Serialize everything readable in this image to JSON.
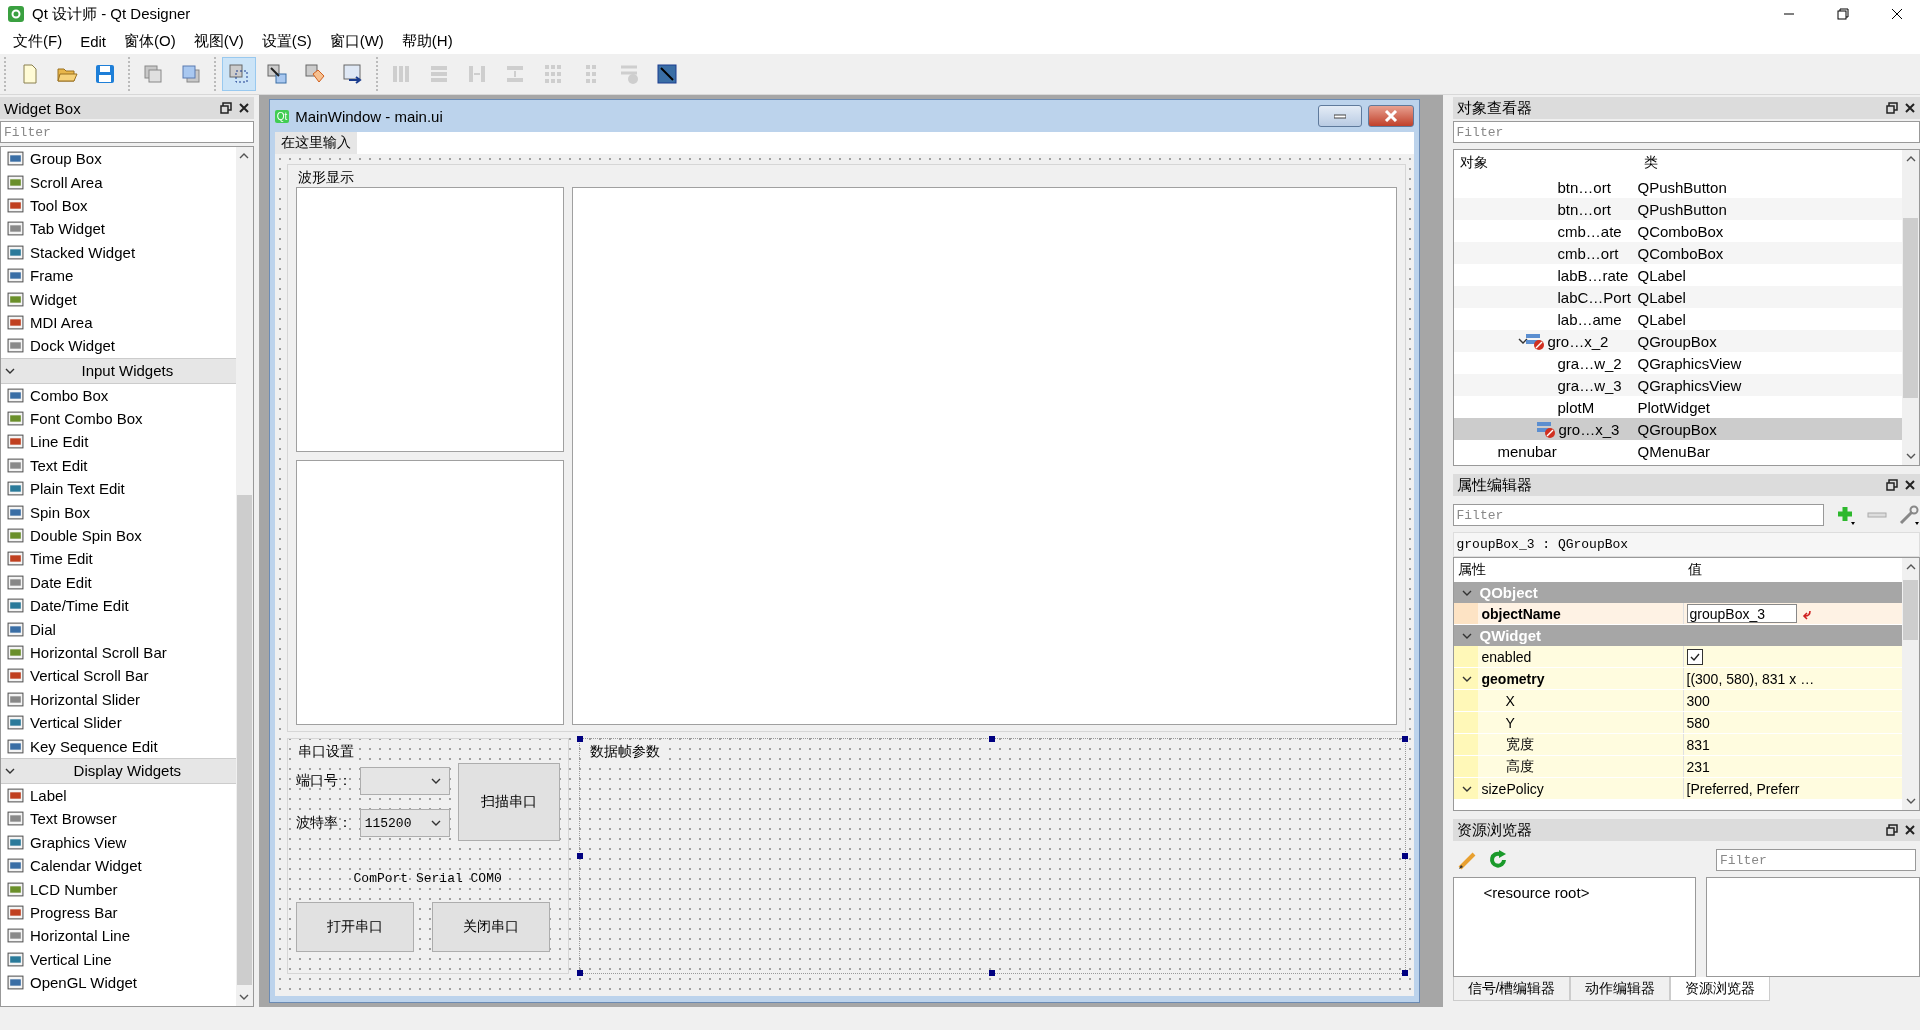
{
  "window": {
    "title": "Qt 设计师 - Qt Designer"
  },
  "menu": [
    "文件(F)",
    "Edit",
    "窗体(O)",
    "视图(V)",
    "设置(S)",
    "窗口(W)",
    "帮助(H)"
  ],
  "toolbar": [
    {
      "buttons": [
        {
          "kind": "new",
          "selected": false,
          "disabled": false
        },
        {
          "kind": "open",
          "selected": false,
          "disabled": false
        },
        {
          "kind": "save",
          "selected": false,
          "disabled": false
        }
      ]
    },
    {
      "buttons": [
        {
          "kind": "front",
          "selected": false,
          "disabled": false
        },
        {
          "kind": "back",
          "selected": false,
          "disabled": false
        }
      ]
    },
    {
      "buttons": [
        {
          "kind": "edit",
          "selected": true,
          "disabled": false
        },
        {
          "kind": "signals",
          "selected": false,
          "disabled": false
        },
        {
          "kind": "buddies",
          "selected": false,
          "disabled": false
        },
        {
          "kind": "taborder",
          "selected": false,
          "disabled": false
        }
      ]
    },
    {
      "buttons": [
        {
          "kind": "hlayout",
          "selected": false,
          "disabled": true
        },
        {
          "kind": "vlayout",
          "selected": false,
          "disabled": true
        },
        {
          "kind": "hsplit",
          "selected": false,
          "disabled": true
        },
        {
          "kind": "vsplit",
          "selected": false,
          "disabled": true
        },
        {
          "kind": "grid",
          "selected": false,
          "disabled": true
        },
        {
          "kind": "form",
          "selected": false,
          "disabled": true
        },
        {
          "kind": "break",
          "selected": false,
          "disabled": true
        },
        {
          "kind": "adjust",
          "selected": false,
          "disabled": false
        }
      ]
    }
  ],
  "widget_box": {
    "title": "Widget Box",
    "filter": {
      "placeholder": "Filter"
    },
    "items": [
      {
        "kind": "item",
        "label": "Group Box"
      },
      {
        "kind": "item",
        "label": "Scroll Area"
      },
      {
        "kind": "item",
        "label": "Tool Box"
      },
      {
        "kind": "item",
        "label": "Tab Widget"
      },
      {
        "kind": "item",
        "label": "Stacked Widget"
      },
      {
        "kind": "item",
        "label": "Frame"
      },
      {
        "kind": "item",
        "label": "Widget"
      },
      {
        "kind": "item",
        "label": "MDI Area"
      },
      {
        "kind": "item",
        "label": "Dock Widget"
      },
      {
        "kind": "category",
        "label": "Input Widgets",
        "expanded": true
      },
      {
        "kind": "item",
        "label": "Combo Box"
      },
      {
        "kind": "item",
        "label": "Font Combo Box"
      },
      {
        "kind": "item",
        "label": "Line Edit"
      },
      {
        "kind": "item",
        "label": "Text Edit"
      },
      {
        "kind": "item",
        "label": "Plain Text Edit"
      },
      {
        "kind": "item",
        "label": "Spin Box"
      },
      {
        "kind": "item",
        "label": "Double Spin Box"
      },
      {
        "kind": "item",
        "label": "Time Edit"
      },
      {
        "kind": "item",
        "label": "Date Edit"
      },
      {
        "kind": "item",
        "label": "Date/Time Edit"
      },
      {
        "kind": "item",
        "label": "Dial"
      },
      {
        "kind": "item",
        "label": "Horizontal Scroll Bar"
      },
      {
        "kind": "item",
        "label": "Vertical Scroll Bar"
      },
      {
        "kind": "item",
        "label": "Horizontal Slider"
      },
      {
        "kind": "item",
        "label": "Vertical Slider"
      },
      {
        "kind": "item",
        "label": "Key Sequence Edit"
      },
      {
        "kind": "category",
        "label": "Display Widgets",
        "expanded": true
      },
      {
        "kind": "item",
        "label": "Label"
      },
      {
        "kind": "item",
        "label": "Text Browser"
      },
      {
        "kind": "item",
        "label": "Graphics View"
      },
      {
        "kind": "item",
        "label": "Calendar Widget"
      },
      {
        "kind": "item",
        "label": "LCD Number"
      },
      {
        "kind": "item",
        "label": "Progress Bar"
      },
      {
        "kind": "item",
        "label": "Horizontal Line"
      },
      {
        "kind": "item",
        "label": "Vertical Line"
      },
      {
        "kind": "item",
        "label": "OpenGL Widget"
      }
    ]
  },
  "form": {
    "logo": "Qt",
    "title": "MainWindow - main.ui",
    "menubar_item": "在这里输入",
    "wave_group": {
      "title": "波形显示",
      "selected": false
    },
    "serial_group": {
      "title": "串口设置",
      "selected": false,
      "port_label": "端口号：",
      "baud_label": "波特率：",
      "baud_value": "115200",
      "scan_button": "扫描串口",
      "status": "ComPort Serial COM0",
      "open_button": "打开串口",
      "close_button": "关闭串口"
    },
    "frame_group": {
      "title": "数据帧参数",
      "selected": true
    }
  },
  "object_inspector": {
    "title": "对象查看器",
    "filter": {
      "placeholder": "Filter"
    },
    "columns": [
      "对象",
      "类"
    ],
    "items": [
      {
        "kind": "widget",
        "object": "btn…ort",
        "class": "QPushButton",
        "selected": false
      },
      {
        "kind": "widget",
        "object": "btn…ort",
        "class": "QPushButton",
        "selected": false
      },
      {
        "kind": "widget",
        "object": "cmb…ate",
        "class": "QComboBox",
        "selected": false
      },
      {
        "kind": "widget",
        "object": "cmb…ort",
        "class": "QComboBox",
        "selected": false
      },
      {
        "kind": "widget",
        "object": "labB…rate",
        "class": "QLabel",
        "selected": false
      },
      {
        "kind": "widget",
        "object": "labC…Port",
        "class": "QLabel",
        "selected": false
      },
      {
        "kind": "widget",
        "object": "lab…ame",
        "class": "QLabel",
        "selected": false
      },
      {
        "kind": "container",
        "object": "gro…x_2",
        "class": "QGroupBox",
        "selected": false,
        "expanded": true,
        "children": [
          {
            "kind": "widget",
            "object": "gra…w_2",
            "class": "QGraphicsView",
            "selected": false
          },
          {
            "kind": "widget",
            "object": "gra…w_3",
            "class": "QGraphicsView",
            "selected": false
          },
          {
            "kind": "widget",
            "object": "plotM",
            "class": "PlotWidget",
            "selected": false
          }
        ]
      },
      {
        "kind": "container",
        "object": "gro…x_3",
        "class": "QGroupBox",
        "selected": true
      }
    ],
    "parent_level_items": [
      {
        "kind": "widget",
        "object": "menubar",
        "class": "QMenuBar",
        "selected": false
      }
    ]
  },
  "property_editor": {
    "title": "属性编辑器",
    "filter": {
      "placeholder": "Filter"
    },
    "object_label": "groupBox_3 : QGroupBox",
    "columns": [
      "属性",
      "值"
    ],
    "groups": [
      {
        "name": "QObject",
        "expanded": true,
        "color": "#fde3c4",
        "rows": [
          {
            "kind": "edit",
            "name": "objectName",
            "modified": true,
            "value": "groupBox_3"
          }
        ]
      },
      {
        "name": "QWidget",
        "expanded": true,
        "color": "#fff8b8",
        "rows": [
          {
            "kind": "checkbox",
            "name": "enabled",
            "modified": false,
            "checked": true
          },
          {
            "kind": "text",
            "name": "geometry",
            "modified": true,
            "value": "[(300, 580), 831 x …",
            "expanded": true,
            "children": [
              {
                "kind": "text",
                "name": "X",
                "modified": false,
                "value": "300"
              },
              {
                "kind": "text",
                "name": "Y",
                "modified": false,
                "value": "580"
              },
              {
                "kind": "text",
                "name": "宽度",
                "modified": false,
                "value": "831"
              },
              {
                "kind": "text",
                "name": "高度",
                "modified": false,
                "value": "231"
              }
            ]
          },
          {
            "kind": "text",
            "name": "sizePolicy",
            "modified": false,
            "value": "[Preferred, Preferr",
            "expanded": true
          }
        ]
      }
    ]
  },
  "resource_browser": {
    "title": "资源浏览器",
    "filter": {
      "placeholder": "Filter"
    },
    "root": "<resource root>"
  },
  "bottom_tabs": [
    {
      "label": "信号/槽编辑器",
      "selected": false
    },
    {
      "label": "动作编辑器",
      "selected": false
    },
    {
      "label": "资源浏览器",
      "selected": true
    }
  ]
}
